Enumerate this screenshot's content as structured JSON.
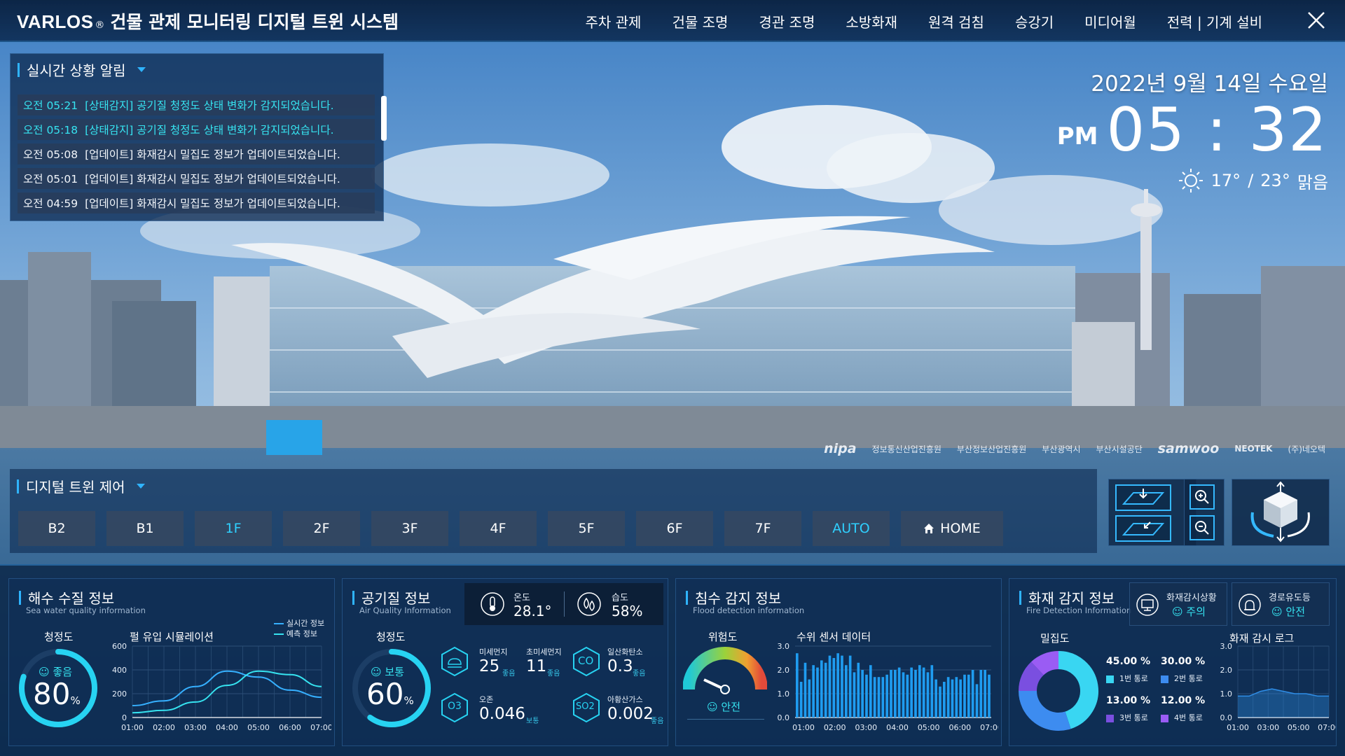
{
  "app": {
    "brand_name": "VARLOS",
    "brand_reg": "®",
    "title": "건물 관제 모니터링 디지털 트윈 시스템"
  },
  "nav": {
    "items": [
      "주차 관제",
      "건물 조명",
      "경관 조명",
      "소방화재",
      "원격 검침",
      "승강기",
      "미디어월",
      "전력 | 기계 설비"
    ]
  },
  "alerts": {
    "title": "실시간 상황 알림",
    "rows": [
      {
        "time": "오전 05:21",
        "text": "[상태감지] 공기질 청정도 상태 변화가 감지되었습니다.",
        "highlight": true
      },
      {
        "time": "오전 05:18",
        "text": "[상태감지] 공기질 청정도 상태 변화가 감지되었습니다.",
        "highlight": true
      },
      {
        "time": "오전 05:08",
        "text": "[업데이트] 화재감시 밀집도 정보가 업데이트되었습니다.",
        "highlight": false
      },
      {
        "time": "오전 05:01",
        "text": "[업데이트] 화재감시 밀집도 정보가 업데이트되었습니다.",
        "highlight": false
      },
      {
        "time": "오전 04:59",
        "text": "[업데이트] 화재감시 밀집도 정보가 업데이트되었습니다.",
        "highlight": false
      }
    ]
  },
  "datetime": {
    "date": "2022년 9월 14일 수요일",
    "ampm": "PM",
    "time": "05 : 32",
    "temp_low": "17°",
    "slash": "/",
    "temp_high": "23°",
    "condition": "맑음"
  },
  "logos": [
    "nipa",
    "정보통신산업진흥원",
    "부산정보산업진흥원",
    "부산광역시",
    "부산시설공단",
    "samwoo",
    "NEOTEK",
    "(주)네오텍"
  ],
  "twin": {
    "title": "디지털 트윈 제어",
    "floors": [
      {
        "label": "B2",
        "active": false
      },
      {
        "label": "B1",
        "active": false
      },
      {
        "label": "1F",
        "active": true
      },
      {
        "label": "2F",
        "active": false
      },
      {
        "label": "3F",
        "active": false
      },
      {
        "label": "4F",
        "active": false
      },
      {
        "label": "5F",
        "active": false
      },
      {
        "label": "6F",
        "active": false
      },
      {
        "label": "7F",
        "active": false
      },
      {
        "label": "AUTO",
        "active": true
      }
    ],
    "home_label": "HOME"
  },
  "seawater": {
    "title": "해수 수질 정보",
    "subtitle": "Sea water quality information",
    "clarity_label": "청정도",
    "status": "좋음",
    "percent": "80",
    "percent_unit": "%",
    "percent_value": 0.8,
    "chart_title": "펄 유입 시뮬레이션",
    "legend": [
      "실시간 정보",
      "예측 정보"
    ]
  },
  "air": {
    "title": "공기질 정보",
    "subtitle": "Air Quality Information",
    "temp_label": "온도",
    "temp_value": "28.1°",
    "humid_label": "습도",
    "humid_value": "58%",
    "clarity_label": "청정도",
    "status": "보통",
    "percent": "60",
    "percent_unit": "%",
    "percent_value": 0.6,
    "items": [
      {
        "name": "미세먼지",
        "value": "25",
        "status": "좋음"
      },
      {
        "name": "초미세먼지",
        "value": "11",
        "status": "좋음"
      },
      {
        "name": "일산화탄소",
        "value": "0.3",
        "status": "좋음",
        "icon_text": "CO"
      },
      {
        "name": "오존",
        "value": "0.046",
        "status": "보통",
        "icon_text": "O3"
      },
      {
        "name": "아황산가스",
        "value": "0.002",
        "status": "좋음",
        "icon_text": "SO2"
      }
    ]
  },
  "flood": {
    "title": "침수 감지 정보",
    "subtitle": "Flood detection information",
    "risk_label": "위험도",
    "risk_status": "안전",
    "chart_title": "수위 센서 데이터"
  },
  "fire": {
    "title": "화재 감지 정보",
    "subtitle": "Fire Detection Information",
    "status1_label": "화재감시상황",
    "status1_value": "주의",
    "status2_label": "경로유도등",
    "status2_value": "안전",
    "density_label": "밀집도",
    "log_title": "화재 감시 로그",
    "routes": [
      {
        "pct": "45.00 %",
        "name": "1번 통로",
        "color": "#39d6f2"
      },
      {
        "pct": "30.00 %",
        "name": "2번 통로",
        "color": "#3d8cf0"
      },
      {
        "pct": "13.00 %",
        "name": "3번 통로",
        "color": "#7a4fe0"
      },
      {
        "pct": "12.00 %",
        "name": "4번 통로",
        "color": "#9a5cf4"
      }
    ]
  },
  "chart_data": [
    {
      "type": "line",
      "title": "펄 유입 시뮬레이션",
      "x": [
        "01:00",
        "02:00",
        "03:00",
        "04:00",
        "05:00",
        "06:00",
        "07:00"
      ],
      "ylim": [
        0,
        600
      ],
      "yticks": [
        0,
        200,
        400,
        600
      ],
      "grid": true,
      "legend_position": "top-right",
      "series": [
        {
          "name": "실시간 정보",
          "color": "#36b0ff",
          "values": [
            100,
            140,
            260,
            390,
            340,
            230,
            170
          ]
        },
        {
          "name": "예측 정보",
          "color": "#36e3f0",
          "values": [
            40,
            60,
            130,
            270,
            390,
            360,
            260
          ]
        }
      ]
    },
    {
      "type": "bar",
      "title": "수위 센서 데이터",
      "x": [
        "01:00",
        "02:00",
        "03:00",
        "04:00",
        "05:00",
        "06:00",
        "07:00"
      ],
      "ylim": [
        0,
        3.0
      ],
      "yticks": [
        0,
        1.0,
        2.0,
        3.0
      ],
      "grid": true,
      "series": [
        {
          "color": "#1f9cf0",
          "values": [
            2.7,
            1.5,
            2.3,
            1.6,
            2.2,
            2.1,
            2.4,
            2.3,
            2.6,
            2.5,
            2.7,
            2.6,
            2.2,
            2.6,
            1.9,
            2.3,
            2.0,
            1.8,
            2.2,
            1.7,
            1.7,
            1.7,
            1.8,
            2.0,
            2.0,
            2.1,
            1.9,
            1.8,
            2.1,
            2.0,
            2.2,
            2.1,
            1.9,
            2.2,
            1.6,
            1.3,
            1.5,
            1.7,
            1.6,
            1.7,
            1.6,
            1.8,
            1.8,
            2.0,
            1.4,
            2.0,
            2.0,
            1.8
          ]
        }
      ]
    },
    {
      "type": "pie",
      "title": "밀집도",
      "categories": [
        "1번 통로",
        "2번 통로",
        "3번 통로",
        "4번 통로"
      ],
      "values": [
        45,
        30,
        13,
        12
      ],
      "colors": [
        "#39d6f2",
        "#3d8cf0",
        "#7a4fe0",
        "#9a5cf4"
      ]
    },
    {
      "type": "area",
      "title": "화재 감시 로그",
      "x": [
        "01:00",
        "03:00",
        "05:00",
        "07:00"
      ],
      "ylim": [
        0,
        3.0
      ],
      "yticks": [
        0,
        1.0,
        2.0,
        3.0
      ],
      "grid": true,
      "series": [
        {
          "color": "#2f8ee8",
          "values": [
            0.9,
            0.9,
            1.1,
            1.2,
            1.1,
            1.0,
            1.0,
            0.9,
            0.9
          ]
        }
      ]
    }
  ]
}
